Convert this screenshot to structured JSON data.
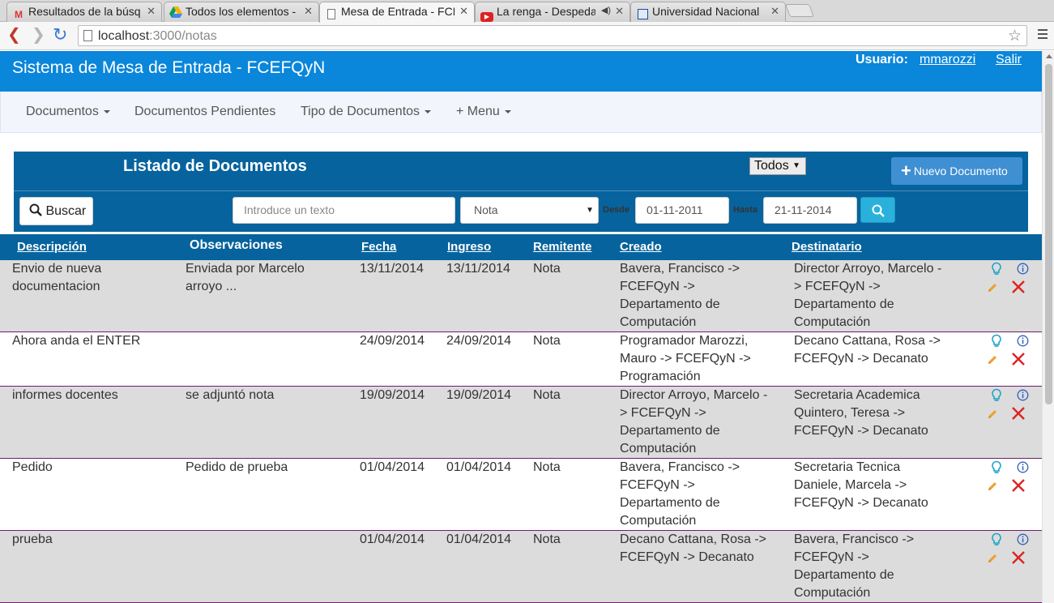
{
  "browser": {
    "tabs": [
      {
        "title": "Resultados de la búsq",
        "icon": "gmail-icon"
      },
      {
        "title": "Todos los elementos -",
        "icon": "drive-icon"
      },
      {
        "title": "Mesa de Entrada - FCE",
        "icon": "page-icon"
      },
      {
        "title": "La renga - Despedaz",
        "icon": "youtube-icon"
      },
      {
        "title": "Universidad Nacional",
        "icon": "site-icon"
      }
    ],
    "url_host": "localhost",
    "url_path": ":3000/notas"
  },
  "header": {
    "title": "Sistema de Mesa de Entrada - FCEFQyN",
    "user_label": "Usuario:",
    "username": "mmarozzi",
    "logout": "Salir",
    "brand_color": "#0a86da"
  },
  "nav": {
    "documentos": "Documentos",
    "pendientes": "Documentos Pendientes",
    "tipos": "Tipo de Documentos",
    "menu": "+ Menu"
  },
  "panel": {
    "title": "Listado de Documentos",
    "scope": "Todos",
    "new_button": "Nuevo Documento",
    "search_button": "Buscar",
    "search_placeholder": "Introduce un texto",
    "type_value": "Nota",
    "desde_label": "Desde",
    "desde_value": "01-11-2011",
    "hasta_label": "Hasta",
    "hasta_value": "21-11-2014",
    "panel_color": "#06639d"
  },
  "table": {
    "headers": {
      "descripcion": "Descripción",
      "observaciones": "Observaciones",
      "fecha": "Fecha",
      "ingreso": "Ingreso",
      "remitente": "Remitente",
      "creado": "Creado",
      "destinatario": "Destinatario"
    },
    "rows": [
      {
        "descripcion": [
          "Envio de nueva",
          "documentacion"
        ],
        "observaciones": [
          "Enviada por Marcelo",
          "arroyo ..."
        ],
        "fecha": "13/11/2014",
        "ingreso": "13/11/2014",
        "remitente": "Nota",
        "creado": [
          "Bavera, Francisco ->",
          "FCEFQyN ->",
          "Departamento de",
          "Computación"
        ],
        "destinatario": [
          "Director Arroyo, Marcelo -",
          "> FCEFQyN ->",
          "Departamento de",
          "Computación"
        ]
      },
      {
        "descripcion": [
          "Ahora anda el ENTER"
        ],
        "observaciones": [],
        "fecha": "24/09/2014",
        "ingreso": "24/09/2014",
        "remitente": "Nota",
        "creado": [
          "Programador Marozzi,",
          "Mauro -> FCEFQyN ->",
          "Programación"
        ],
        "destinatario": [
          "Decano Cattana, Rosa ->",
          "FCEFQyN -> Decanato"
        ]
      },
      {
        "descripcion": [
          "informes docentes"
        ],
        "observaciones": [
          "se adjuntó nota"
        ],
        "fecha": "19/09/2014",
        "ingreso": "19/09/2014",
        "remitente": "Nota",
        "creado": [
          "Director Arroyo, Marcelo -",
          "> FCEFQyN ->",
          "Departamento de",
          "Computación"
        ],
        "destinatario": [
          "Secretaria Academica",
          "Quintero, Teresa ->",
          "FCEFQyN -> Decanato"
        ]
      },
      {
        "descripcion": [
          "Pedido"
        ],
        "observaciones": [
          "Pedido de prueba"
        ],
        "fecha": "01/04/2014",
        "ingreso": "01/04/2014",
        "remitente": "Nota",
        "creado": [
          "Bavera, Francisco ->",
          "FCEFQyN ->",
          "Departamento de",
          "Computación"
        ],
        "destinatario": [
          "Secretaria Tecnica",
          "Daniele, Marcela ->",
          "FCEFQyN -> Decanato"
        ]
      },
      {
        "descripcion": [
          "prueba"
        ],
        "observaciones": [],
        "fecha": "01/04/2014",
        "ingreso": "01/04/2014",
        "remitente": "Nota",
        "creado": [
          "Decano Cattana, Rosa ->",
          "FCEFQyN -> Decanato"
        ],
        "destinatario": [
          "Bavera, Francisco ->",
          "FCEFQyN ->",
          "Departamento de",
          "Computación"
        ]
      }
    ],
    "row_actions": [
      "lightbulb-icon",
      "info-icon",
      "pencil-icon",
      "delete-x-icon"
    ]
  }
}
